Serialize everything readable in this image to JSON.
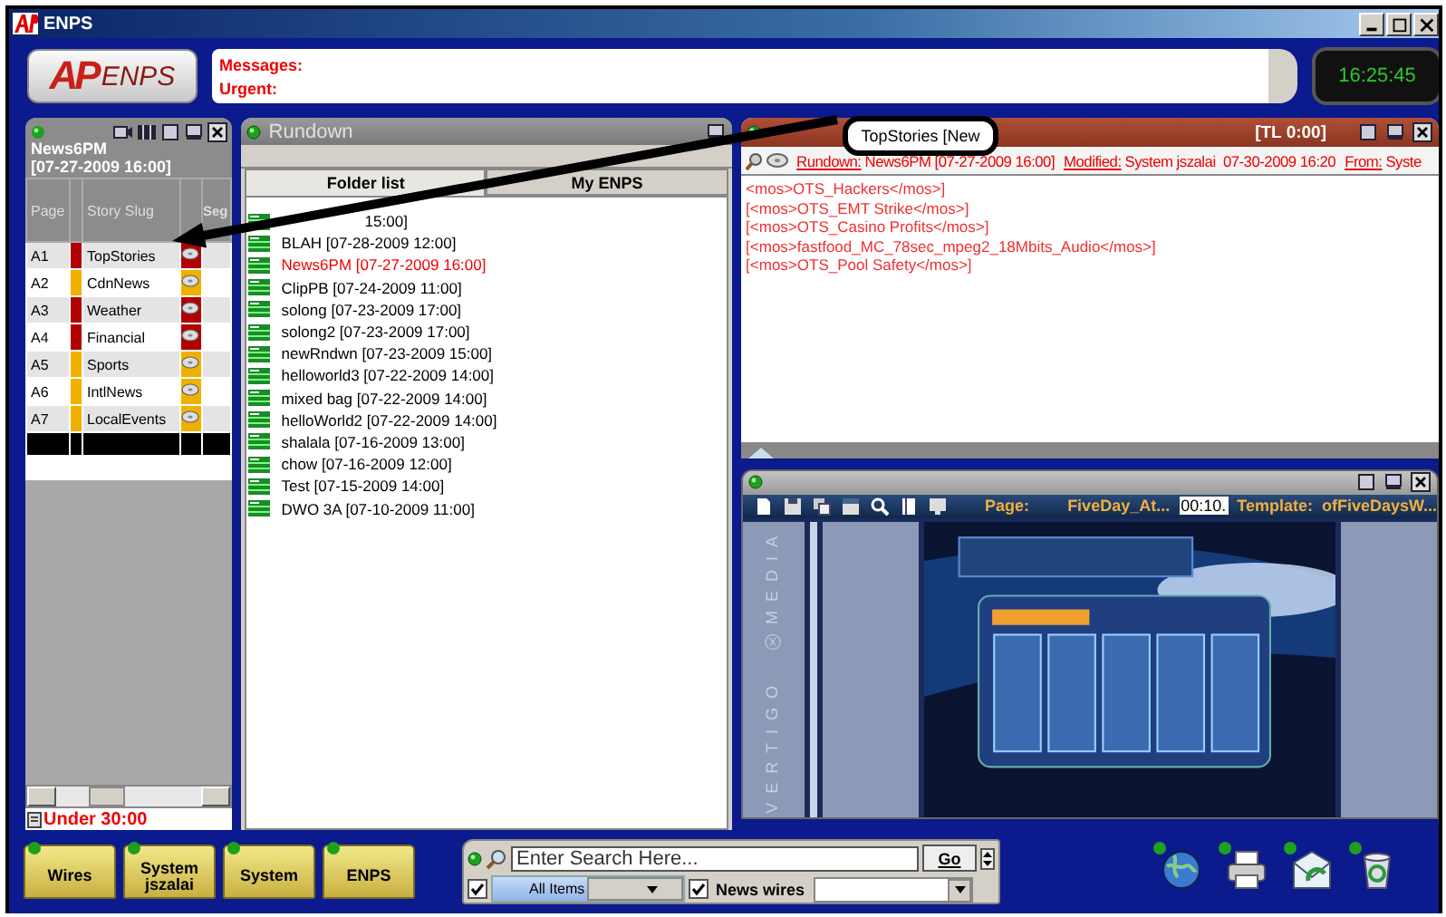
{
  "window": {
    "title": "ENPS"
  },
  "header": {
    "logo": {
      "mark": "AP",
      "name": "ENPS"
    },
    "messages_label": "Messages:",
    "urgent_label": "Urgent:",
    "clock": "16:25:45"
  },
  "story_list": {
    "title": "News6PM [07-27-2009 16:00]",
    "columns": [
      "Page",
      "Story Slug",
      "Seg"
    ],
    "rows": [
      {
        "page": "A1",
        "slug": "TopStories",
        "color": "#b00000"
      },
      {
        "page": "A2",
        "slug": "CdnNews",
        "color": "#f0b000"
      },
      {
        "page": "A3",
        "slug": "Weather",
        "color": "#b00000"
      },
      {
        "page": "A4",
        "slug": "Financial",
        "color": "#b00000"
      },
      {
        "page": "A5",
        "slug": "Sports",
        "color": "#f0b000"
      },
      {
        "page": "A6",
        "slug": "IntlNews",
        "color": "#f0b000"
      },
      {
        "page": "A7",
        "slug": "LocalEvents",
        "color": "#f0b000"
      }
    ],
    "status": "Under 30:00"
  },
  "rundown": {
    "title": "Rundown",
    "tabs": [
      {
        "label": "Folder list",
        "selected": true
      },
      {
        "label": "My ENPS",
        "selected": false
      }
    ],
    "items": [
      {
        "tail": "15:00]",
        "selected": false
      },
      {
        "label": "BLAH [07-28-2009 12:00]",
        "selected": false
      },
      {
        "label": "News6PM [07-27-2009 16:00]",
        "selected": true
      },
      {
        "label": "ClipPB [07-24-2009 11:00]",
        "selected": false
      },
      {
        "label": "solong [07-23-2009 17:00]",
        "selected": false
      },
      {
        "label": "solong2 [07-23-2009 17:00]",
        "selected": false
      },
      {
        "label": "newRndwn [07-23-2009 15:00]",
        "selected": false
      },
      {
        "label": "helloworld3 [07-22-2009 14:00]",
        "selected": false
      },
      {
        "label": "mixed bag [07-22-2009 14:00]",
        "selected": false
      },
      {
        "label": "helloWorld2 [07-22-2009 14:00]",
        "selected": false
      },
      {
        "label": "shalala [07-16-2009 13:00]",
        "selected": false
      },
      {
        "label": "chow [07-16-2009 12:00]",
        "selected": false
      },
      {
        "label": "Test [07-15-2009 14:00]",
        "selected": false
      },
      {
        "label": "DWO 3A [07-10-2009 11:00]",
        "selected": false
      }
    ]
  },
  "story": {
    "callout": "TopStories [New",
    "timing": "[TL 0:00]",
    "fields": [
      {
        "label": "Rundown:",
        "value": "News6PM [07-27-2009 16:00]"
      },
      {
        "label": "Modified:",
        "value": "System jszalai  07-30-2009 16:20"
      },
      {
        "label": "From:",
        "value": "Syste"
      }
    ],
    "lines": [
      "<mos>OTS_Hackers</mos>]",
      "[<mos>OTS_EMT Strike</mos>]",
      "[<mos>OTS_Casino Profits</mos>]",
      "[<mos>fastfood_MC_78sec_mpeg2_18Mbits_Audio</mos>]",
      "[<mos>OTS_Pool Safety</mos>]"
    ]
  },
  "vertigo": {
    "page_label": "Page:",
    "page": "FiveDay_At...",
    "time": "00:10.",
    "template_label": "Template:",
    "template": "ofFiveDaysW...",
    "brand": "VERTIGO ⓧ MEDIA"
  },
  "bottom": {
    "folders": [
      "Wires",
      "System jszalai",
      "System",
      "ENPS"
    ],
    "search": {
      "placeholder": "Enter Search Here...",
      "button": "Go"
    },
    "filter": {
      "label": "All Items",
      "checked": true
    },
    "news_wires": {
      "label": "News wires",
      "checked": true
    }
  }
}
